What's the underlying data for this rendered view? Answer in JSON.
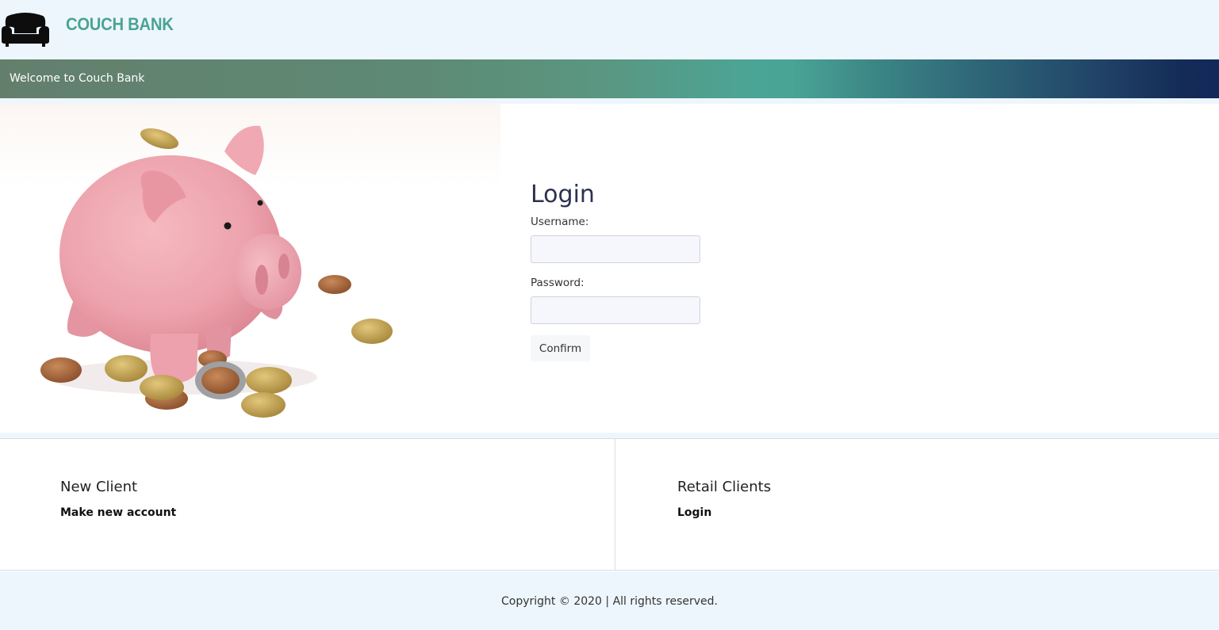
{
  "header": {
    "brand": "COUCH BANK",
    "logo_icon": "couch-icon"
  },
  "banner": {
    "text": "Welcome to Couch Bank"
  },
  "hero": {
    "image_subject": "piggy-bank-with-coins"
  },
  "login": {
    "title": "Login",
    "username_label": "Username:",
    "username_value": "",
    "password_label": "Password:",
    "password_value": "",
    "confirm_label": "Confirm"
  },
  "cards": [
    {
      "title": "New Client",
      "link": "Make new account"
    },
    {
      "title": "Retail Clients",
      "link": "Login"
    }
  ],
  "footer": {
    "copyright": "Copyright © 2020 | All rights reserved."
  },
  "colors": {
    "brand": "#4aa394",
    "header_bg": "#eef6fd",
    "login_title": "#2d3150",
    "banner_start": "#637f6c",
    "banner_mid": "#49a495",
    "banner_end": "#12295a"
  }
}
